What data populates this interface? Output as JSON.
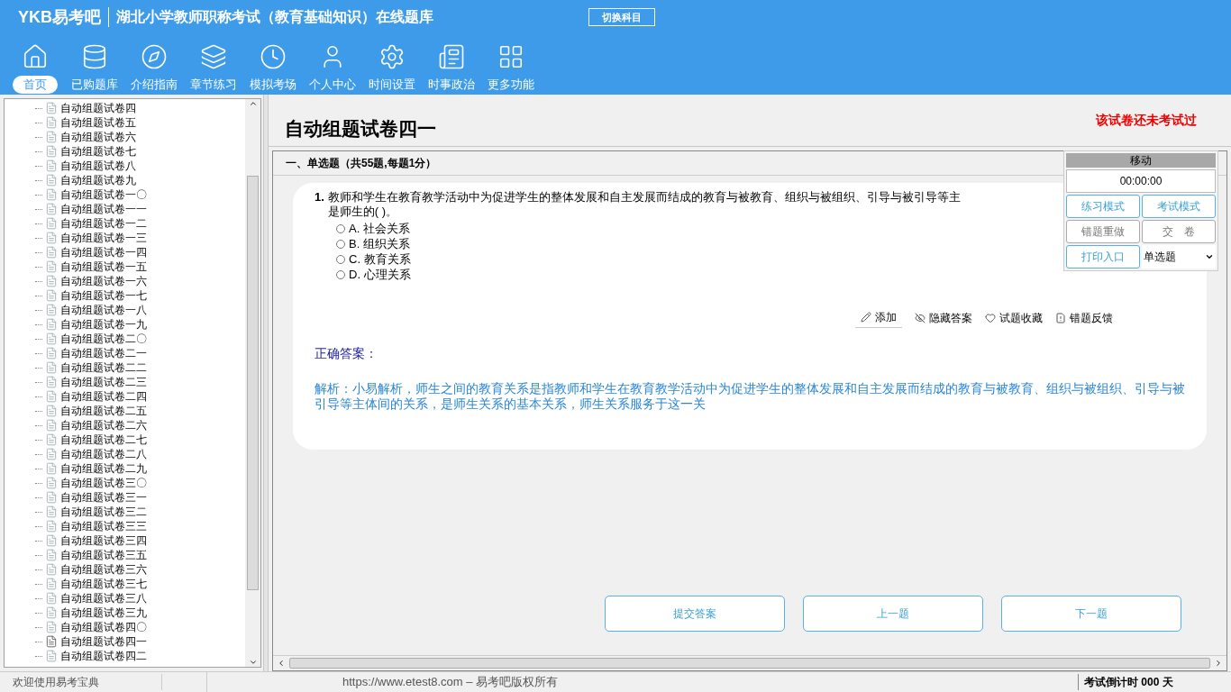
{
  "header": {
    "logo": "YKB易考吧",
    "title": "湖北小学教师职称考试（教育基础知识）在线题库",
    "switch_button": "切换科目"
  },
  "nav": [
    {
      "label": "首页",
      "selected": true
    },
    {
      "label": "已购题库",
      "selected": false
    },
    {
      "label": "介绍指南",
      "selected": false
    },
    {
      "label": "章节练习",
      "selected": false
    },
    {
      "label": "模拟考场",
      "selected": false
    },
    {
      "label": "个人中心",
      "selected": false
    },
    {
      "label": "时间设置",
      "selected": false
    },
    {
      "label": "时事政治",
      "selected": false
    },
    {
      "label": "更多功能",
      "selected": false
    }
  ],
  "tree": [
    {
      "label": "自动组题试卷四",
      "current": false
    },
    {
      "label": "自动组题试卷五",
      "current": false
    },
    {
      "label": "自动组题试卷六",
      "current": false
    },
    {
      "label": "自动组题试卷七",
      "current": false
    },
    {
      "label": "自动组题试卷八",
      "current": false
    },
    {
      "label": "自动组题试卷九",
      "current": false
    },
    {
      "label": "自动组题试卷一〇",
      "current": false
    },
    {
      "label": "自动组题试卷一一",
      "current": false
    },
    {
      "label": "自动组题试卷一二",
      "current": false
    },
    {
      "label": "自动组题试卷一三",
      "current": false
    },
    {
      "label": "自动组题试卷一四",
      "current": false
    },
    {
      "label": "自动组题试卷一五",
      "current": false
    },
    {
      "label": "自动组题试卷一六",
      "current": false
    },
    {
      "label": "自动组题试卷一七",
      "current": false
    },
    {
      "label": "自动组题试卷一八",
      "current": false
    },
    {
      "label": "自动组题试卷一九",
      "current": false
    },
    {
      "label": "自动组题试卷二〇",
      "current": false
    },
    {
      "label": "自动组题试卷二一",
      "current": false
    },
    {
      "label": "自动组题试卷二二",
      "current": false
    },
    {
      "label": "自动组题试卷二三",
      "current": false
    },
    {
      "label": "自动组题试卷二四",
      "current": false
    },
    {
      "label": "自动组题试卷二五",
      "current": false
    },
    {
      "label": "自动组题试卷二六",
      "current": false
    },
    {
      "label": "自动组题试卷二七",
      "current": false
    },
    {
      "label": "自动组题试卷二八",
      "current": false
    },
    {
      "label": "自动组题试卷二九",
      "current": false
    },
    {
      "label": "自动组题试卷三〇",
      "current": false
    },
    {
      "label": "自动组题试卷三一",
      "current": false
    },
    {
      "label": "自动组题试卷三二",
      "current": false
    },
    {
      "label": "自动组题试卷三三",
      "current": false
    },
    {
      "label": "自动组题试卷三四",
      "current": false
    },
    {
      "label": "自动组题试卷三五",
      "current": false
    },
    {
      "label": "自动组题试卷三六",
      "current": false
    },
    {
      "label": "自动组题试卷三七",
      "current": false
    },
    {
      "label": "自动组题试卷三八",
      "current": false
    },
    {
      "label": "自动组题试卷三九",
      "current": false
    },
    {
      "label": "自动组题试卷四〇",
      "current": false
    },
    {
      "label": "自动组题试卷四一",
      "current": true
    },
    {
      "label": "自动组题试卷四二",
      "current": false
    }
  ],
  "paper": {
    "title": "自动组题试卷四一",
    "status": "该试卷还未考试过",
    "section": "一、单选题（共55题,每题1分）"
  },
  "question": {
    "number": "1.",
    "text": "教师和学生在教育教学活动中为促进学生的整体发展和自主发展而结成的教育与被教育、组织与被组织、引导与被引导等主",
    "text_2": "是师生的( )。",
    "options": [
      {
        "label": "A. 社会关系",
        "selected": false
      },
      {
        "label": "B. 组织关系",
        "selected": false
      },
      {
        "label": "C. 教育关系",
        "selected": false
      },
      {
        "label": "D. 心理关系",
        "selected": false
      }
    ],
    "tools": [
      "添加",
      "隐藏答案",
      "试题收藏",
      "错题反馈"
    ],
    "answer": "正确答案：",
    "analysis": "解析：小易解析，师生之间的教育关系是指教师和学生在教育教学活动中为促进学生的整体发展和自主发展而结成的教育与被教育、组织与被组织、引导与被引导等主体间的关系，是师生关系的基本关系，师生关系服务于这一关"
  },
  "panel": {
    "header": "移动",
    "timer": "00:00:00",
    "buttons": [
      {
        "label": "练习模式",
        "disabled": false
      },
      {
        "label": "考试模式",
        "disabled": false
      },
      {
        "label": "错题重做",
        "disabled": true
      },
      {
        "label": "交　卷",
        "disabled": true
      },
      {
        "label": "打印入口",
        "disabled": false
      }
    ],
    "type_select": "单选题"
  },
  "actions": [
    "提交答案",
    "上一题",
    "下一题"
  ],
  "status_bar": {
    "welcome": "欢迎使用易考宝典",
    "copyright": "https://www.etest8.com – 易考吧版权所有",
    "countdown": "考试倒计时 000 天"
  }
}
